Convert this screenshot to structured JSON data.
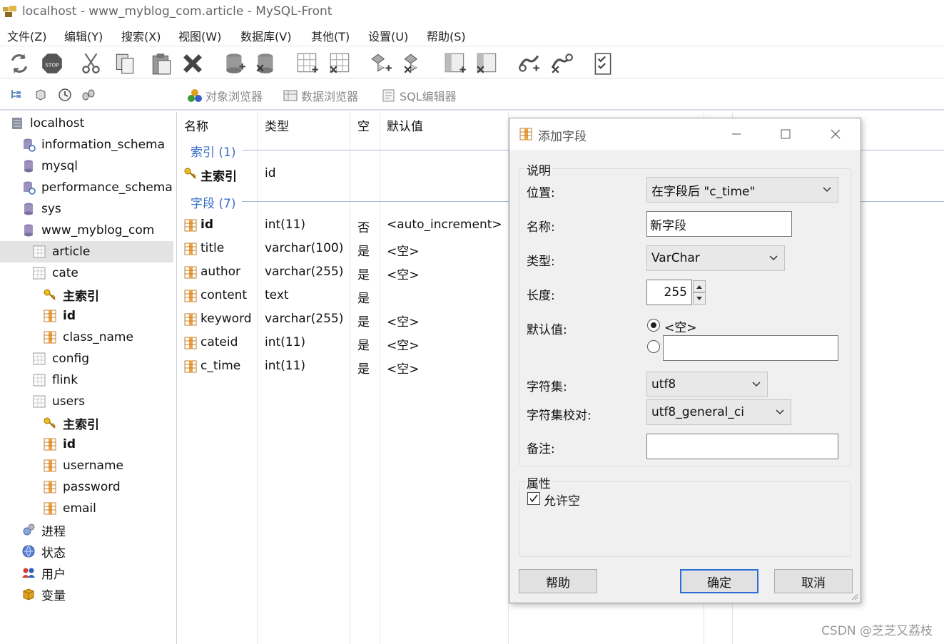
{
  "window": {
    "title": "localhost - www_myblog_com.article - MySQL-Front"
  },
  "menu": [
    "文件(Z)",
    "编辑(Y)",
    "搜索(X)",
    "视图(W)",
    "数据库(V)",
    "其他(T)",
    "设置(U)",
    "帮助(S)"
  ],
  "toolbar": {
    "icons": [
      "refresh-icon",
      "stop-icon",
      "cut-icon",
      "copy-icon",
      "paste-icon",
      "delete-icon",
      "add-database-icon",
      "drop-database-icon",
      "add-table-icon",
      "drop-table-icon",
      "add-field-icon",
      "drop-field-icon",
      "add-index-icon",
      "drop-index-icon",
      "add-foreign-key-icon",
      "drop-foreign-key-icon",
      "properties-icon"
    ]
  },
  "toolbar2": {
    "tabs": [
      "对象浏览器",
      "数据浏览器",
      "SQL编辑器"
    ]
  },
  "sidebar": {
    "items": [
      {
        "label": "localhost",
        "icon": "server-icon",
        "level": 0
      },
      {
        "label": "information_schema",
        "icon": "system-database-icon",
        "level": 1
      },
      {
        "label": "mysql",
        "icon": "database-icon",
        "level": 1
      },
      {
        "label": "performance_schema",
        "icon": "system-database-icon",
        "level": 1
      },
      {
        "label": "sys",
        "icon": "database-icon",
        "level": 1
      },
      {
        "label": "www_myblog_com",
        "icon": "database-icon",
        "level": 1
      },
      {
        "label": "article",
        "icon": "table-icon",
        "level": 2,
        "selected": true
      },
      {
        "label": "cate",
        "icon": "table-icon",
        "level": 2
      },
      {
        "label": "主索引",
        "icon": "key-icon",
        "level": 3,
        "bold": true
      },
      {
        "label": "id",
        "icon": "field-icon",
        "level": 3,
        "bold": true
      },
      {
        "label": "class_name",
        "icon": "field-icon",
        "level": 3
      },
      {
        "label": "config",
        "icon": "table-icon",
        "level": 2
      },
      {
        "label": "flink",
        "icon": "table-icon",
        "level": 2
      },
      {
        "label": "users",
        "icon": "table-icon",
        "level": 2
      },
      {
        "label": "主索引",
        "icon": "key-icon",
        "level": 3,
        "bold": true
      },
      {
        "label": "id",
        "icon": "field-icon",
        "level": 3,
        "bold": true
      },
      {
        "label": "username",
        "icon": "field-icon",
        "level": 3
      },
      {
        "label": "password",
        "icon": "field-icon",
        "level": 3
      },
      {
        "label": "email",
        "icon": "field-icon",
        "level": 3
      },
      {
        "label": "进程",
        "icon": "process-icon",
        "level": 1
      },
      {
        "label": "状态",
        "icon": "status-icon",
        "level": 1
      },
      {
        "label": "用户",
        "icon": "users-icon",
        "level": 1
      },
      {
        "label": "变量",
        "icon": "variables-icon",
        "level": 1
      }
    ]
  },
  "grid": {
    "columns": [
      "名称",
      "类型",
      "空",
      "默认值"
    ],
    "index_group": "索引 (1)",
    "indexes": [
      {
        "name": "主索引",
        "type": "id"
      }
    ],
    "field_group": "字段 (7)",
    "fields": [
      {
        "name": "id",
        "type": "int(11)",
        "null": "否",
        "default": "<auto_increment>",
        "bold": true
      },
      {
        "name": "title",
        "type": "varchar(100)",
        "null": "是",
        "default": "<空>"
      },
      {
        "name": "author",
        "type": "varchar(255)",
        "null": "是",
        "default": "<空>"
      },
      {
        "name": "content",
        "type": "text",
        "null": "是",
        "default": ""
      },
      {
        "name": "keyword",
        "type": "varchar(255)",
        "null": "是",
        "default": "<空>"
      },
      {
        "name": "cateid",
        "type": "int(11)",
        "null": "是",
        "default": "<空>"
      },
      {
        "name": "c_time",
        "type": "int(11)",
        "null": "是",
        "default": "<空>"
      }
    ]
  },
  "dialog": {
    "title": "添加字段",
    "section_desc": "说明",
    "position_label": "位置:",
    "position_value": "在字段后 \"c_time\"",
    "name_label": "名称:",
    "name_value": "新字段",
    "type_label": "类型:",
    "type_value": "VarChar",
    "length_label": "长度:",
    "length_value": "255",
    "default_label": "默认值:",
    "default_option_empty": "<空>",
    "default_custom_value": "",
    "charset_label": "字符集:",
    "charset_value": "utf8",
    "collation_label": "字符集校对:",
    "collation_value": "utf8_general_ci",
    "comment_label": "备注:",
    "comment_value": "",
    "section_attr": "属性",
    "allow_null_label": "允许空",
    "allow_null_checked": true,
    "help_button": "帮助",
    "ok_button": "确定",
    "cancel_button": "取消"
  },
  "watermark": "CSDN @芝芝又荔枝"
}
